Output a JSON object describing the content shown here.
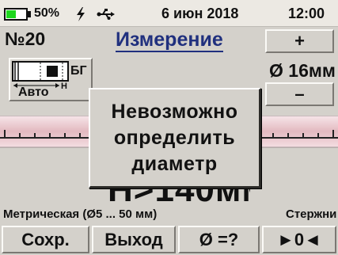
{
  "status": {
    "battery_percent": 50,
    "battery_label": "50%",
    "charging_icon": "bolt-icon",
    "usb_icon": "usb-icon",
    "date": "6 июн 2018",
    "time": "12:00"
  },
  "header": {
    "number": "№20",
    "title": "Измерение"
  },
  "controls": {
    "plus_label": "+",
    "minus_label": "–",
    "diameter": "Ø 16мм"
  },
  "mode": {
    "icon": "rebar-mode-icon",
    "bg_label": "БГ",
    "auto_label": "Авто"
  },
  "dialog": {
    "lines": [
      "Невозможно",
      "определить",
      "диаметр"
    ]
  },
  "measurement": {
    "value": "H>140мм"
  },
  "info": {
    "range": "Метрическая (Ø5 ... 50 мм)",
    "type": "Стержни"
  },
  "softkeys": {
    "save": "Сохр.",
    "exit": "Выход",
    "diameter": "Ø =?",
    "zero": "►0◄"
  },
  "colors": {
    "background": "#d4d1cb",
    "title": "#20307e",
    "battery": "#1ed81e",
    "rebar": "#e9c6cc"
  }
}
